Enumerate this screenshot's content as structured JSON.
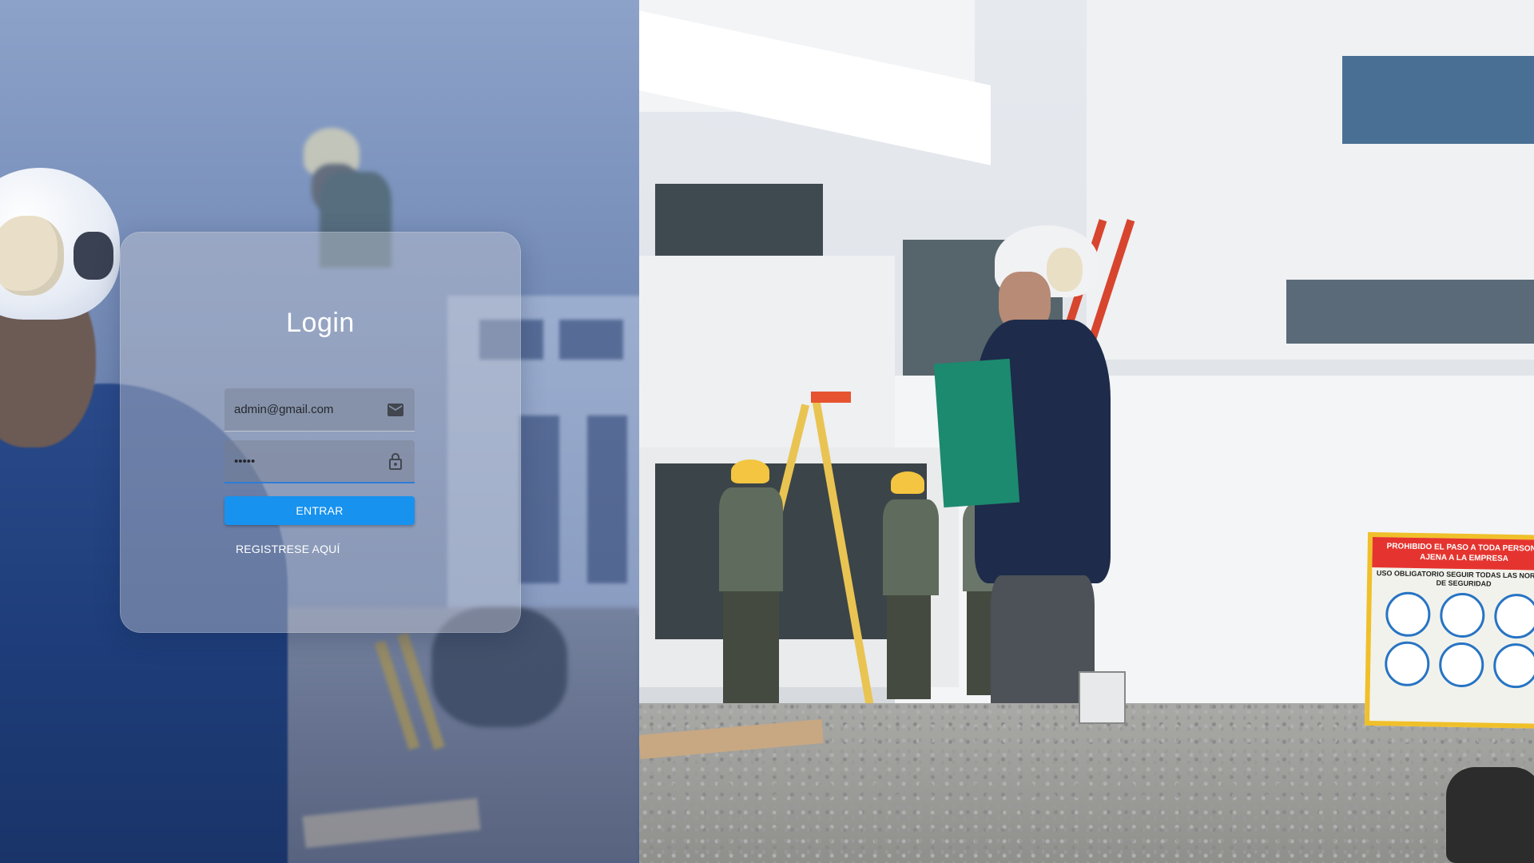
{
  "login": {
    "title": "Login",
    "email_value": "admin@gmail.com",
    "password_value": "•••••",
    "email_icon": "mail-icon",
    "password_icon": "lock-icon",
    "submit_label": "ENTRAR",
    "register_label": "REGISTRESE AQUÍ"
  },
  "colors": {
    "primary_button": "#1792ef",
    "active_underline": "#2e7cd6"
  },
  "sign": {
    "headline": "PROHIBIDO EL PASO A TODA PERSONA AJENA A LA EMPRESA",
    "subline": "USO OBLIGATORIO SEGUIR TODAS LAS NORMAS DE SEGURIDAD"
  }
}
